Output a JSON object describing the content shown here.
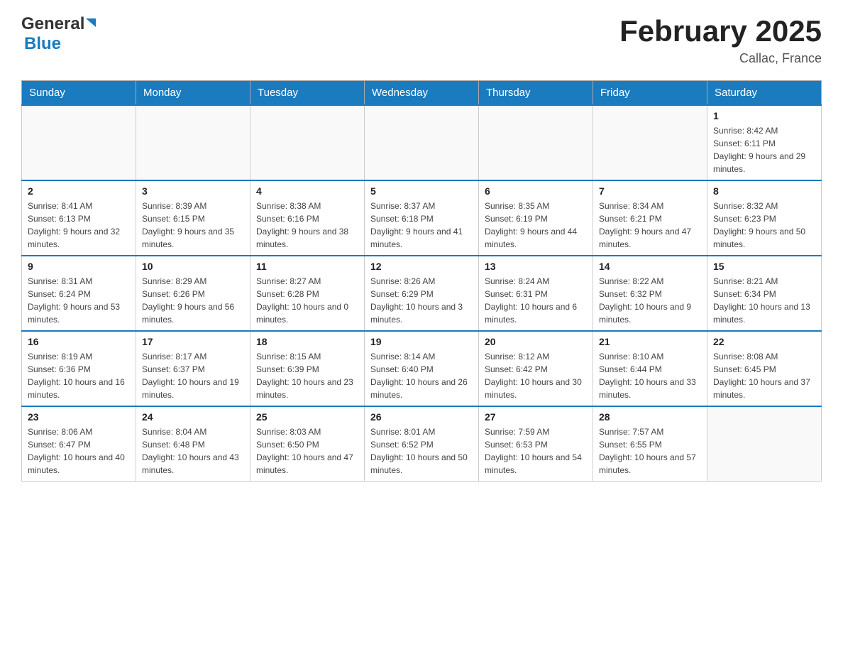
{
  "header": {
    "logo_text_black": "General",
    "logo_text_blue": "Blue",
    "month_title": "February 2025",
    "location": "Callac, France"
  },
  "weekdays": [
    "Sunday",
    "Monday",
    "Tuesday",
    "Wednesday",
    "Thursday",
    "Friday",
    "Saturday"
  ],
  "weeks": [
    [
      {
        "day": "",
        "info": ""
      },
      {
        "day": "",
        "info": ""
      },
      {
        "day": "",
        "info": ""
      },
      {
        "day": "",
        "info": ""
      },
      {
        "day": "",
        "info": ""
      },
      {
        "day": "",
        "info": ""
      },
      {
        "day": "1",
        "info": "Sunrise: 8:42 AM\nSunset: 6:11 PM\nDaylight: 9 hours and 29 minutes."
      }
    ],
    [
      {
        "day": "2",
        "info": "Sunrise: 8:41 AM\nSunset: 6:13 PM\nDaylight: 9 hours and 32 minutes."
      },
      {
        "day": "3",
        "info": "Sunrise: 8:39 AM\nSunset: 6:15 PM\nDaylight: 9 hours and 35 minutes."
      },
      {
        "day": "4",
        "info": "Sunrise: 8:38 AM\nSunset: 6:16 PM\nDaylight: 9 hours and 38 minutes."
      },
      {
        "day": "5",
        "info": "Sunrise: 8:37 AM\nSunset: 6:18 PM\nDaylight: 9 hours and 41 minutes."
      },
      {
        "day": "6",
        "info": "Sunrise: 8:35 AM\nSunset: 6:19 PM\nDaylight: 9 hours and 44 minutes."
      },
      {
        "day": "7",
        "info": "Sunrise: 8:34 AM\nSunset: 6:21 PM\nDaylight: 9 hours and 47 minutes."
      },
      {
        "day": "8",
        "info": "Sunrise: 8:32 AM\nSunset: 6:23 PM\nDaylight: 9 hours and 50 minutes."
      }
    ],
    [
      {
        "day": "9",
        "info": "Sunrise: 8:31 AM\nSunset: 6:24 PM\nDaylight: 9 hours and 53 minutes."
      },
      {
        "day": "10",
        "info": "Sunrise: 8:29 AM\nSunset: 6:26 PM\nDaylight: 9 hours and 56 minutes."
      },
      {
        "day": "11",
        "info": "Sunrise: 8:27 AM\nSunset: 6:28 PM\nDaylight: 10 hours and 0 minutes."
      },
      {
        "day": "12",
        "info": "Sunrise: 8:26 AM\nSunset: 6:29 PM\nDaylight: 10 hours and 3 minutes."
      },
      {
        "day": "13",
        "info": "Sunrise: 8:24 AM\nSunset: 6:31 PM\nDaylight: 10 hours and 6 minutes."
      },
      {
        "day": "14",
        "info": "Sunrise: 8:22 AM\nSunset: 6:32 PM\nDaylight: 10 hours and 9 minutes."
      },
      {
        "day": "15",
        "info": "Sunrise: 8:21 AM\nSunset: 6:34 PM\nDaylight: 10 hours and 13 minutes."
      }
    ],
    [
      {
        "day": "16",
        "info": "Sunrise: 8:19 AM\nSunset: 6:36 PM\nDaylight: 10 hours and 16 minutes."
      },
      {
        "day": "17",
        "info": "Sunrise: 8:17 AM\nSunset: 6:37 PM\nDaylight: 10 hours and 19 minutes."
      },
      {
        "day": "18",
        "info": "Sunrise: 8:15 AM\nSunset: 6:39 PM\nDaylight: 10 hours and 23 minutes."
      },
      {
        "day": "19",
        "info": "Sunrise: 8:14 AM\nSunset: 6:40 PM\nDaylight: 10 hours and 26 minutes."
      },
      {
        "day": "20",
        "info": "Sunrise: 8:12 AM\nSunset: 6:42 PM\nDaylight: 10 hours and 30 minutes."
      },
      {
        "day": "21",
        "info": "Sunrise: 8:10 AM\nSunset: 6:44 PM\nDaylight: 10 hours and 33 minutes."
      },
      {
        "day": "22",
        "info": "Sunrise: 8:08 AM\nSunset: 6:45 PM\nDaylight: 10 hours and 37 minutes."
      }
    ],
    [
      {
        "day": "23",
        "info": "Sunrise: 8:06 AM\nSunset: 6:47 PM\nDaylight: 10 hours and 40 minutes."
      },
      {
        "day": "24",
        "info": "Sunrise: 8:04 AM\nSunset: 6:48 PM\nDaylight: 10 hours and 43 minutes."
      },
      {
        "day": "25",
        "info": "Sunrise: 8:03 AM\nSunset: 6:50 PM\nDaylight: 10 hours and 47 minutes."
      },
      {
        "day": "26",
        "info": "Sunrise: 8:01 AM\nSunset: 6:52 PM\nDaylight: 10 hours and 50 minutes."
      },
      {
        "day": "27",
        "info": "Sunrise: 7:59 AM\nSunset: 6:53 PM\nDaylight: 10 hours and 54 minutes."
      },
      {
        "day": "28",
        "info": "Sunrise: 7:57 AM\nSunset: 6:55 PM\nDaylight: 10 hours and 57 minutes."
      },
      {
        "day": "",
        "info": ""
      }
    ]
  ]
}
